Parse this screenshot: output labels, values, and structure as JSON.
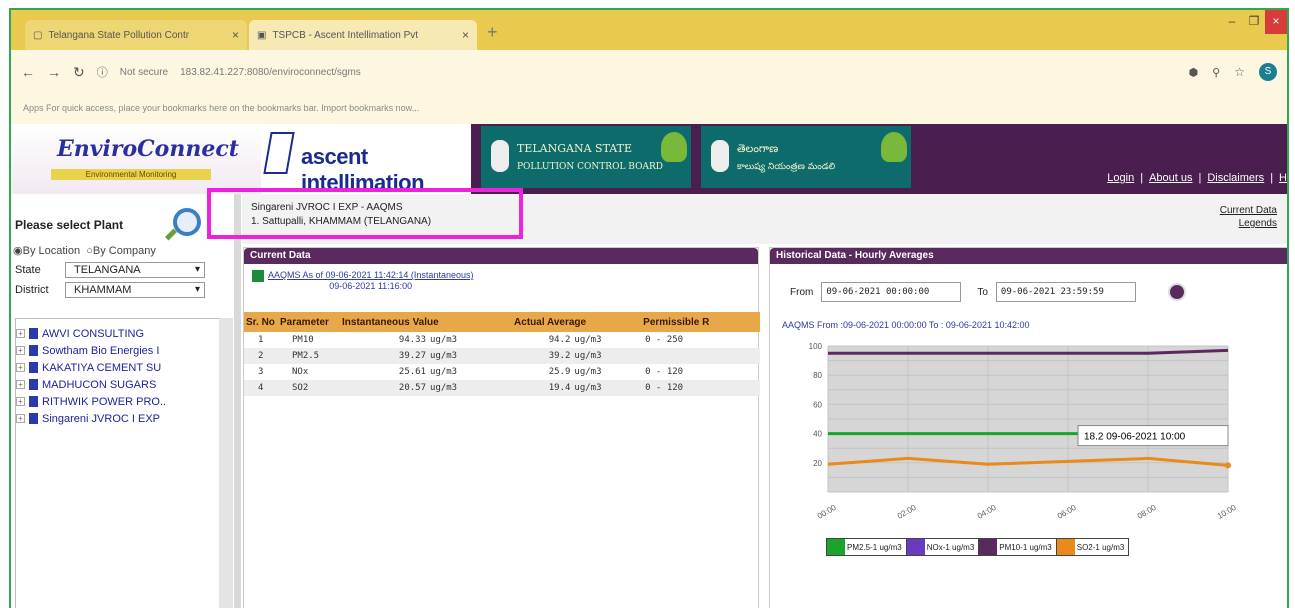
{
  "browser": {
    "tabs": [
      {
        "label": "Telangana State Pollution Contr",
        "active": false
      },
      {
        "label": "TSPCB - Ascent Intellimation Pvt",
        "active": true
      }
    ],
    "url_prefix": "Not secure",
    "url": "183.82.41.227:8080/enviroconnect/sgms",
    "bookmarks_text": "Apps   For quick access, place your bookmarks here on the bookmarks bar. Import bookmarks now...",
    "profile_initial": "S"
  },
  "header": {
    "brand": "EnviroConnect",
    "brand_sub": "Environmental Monitoring",
    "ascent": "ascent intellimation",
    "ts_line1": "TELANGANA STATE",
    "ts_line2": "POLLUTION CONTROL BOARD",
    "telugu_line1": "తెలంగాణ",
    "telugu_line2": "కాలుష్య నియంత్రణ మండలి",
    "links": [
      "Login",
      "About us",
      "Disclaimers",
      "H"
    ]
  },
  "sidebar": {
    "prompt": "Please select Plant",
    "radio_location": "By Location",
    "radio_company": "By Company",
    "state_label": "State",
    "state_value": "TELANGANA",
    "district_label": "District",
    "district_value": "KHAMMAM",
    "plants": [
      "AWVI CONSULTING",
      "Sowtham Bio Energies I",
      "KAKATIYA CEMENT SU",
      "MADHUCON SUGARS",
      "RITHWIK POWER PRO..",
      "Singareni JVROC I EXP"
    ]
  },
  "location": {
    "line1": "Singareni JVROC I EXP - AAQMS",
    "line2": "1. Sattupalli, KHAMMAM (TELANGANA)",
    "link1": "Current Data",
    "link2": "Legends"
  },
  "current": {
    "heading": "Current Data",
    "asof_line1": "AAQMS As of 09-06-2021 11:42:14 (Instantaneous)",
    "asof_line2": "09-06-2021 11:16:00",
    "columns": [
      "Sr. No",
      "Parameter",
      "Instantaneous Value",
      "Actual Average",
      "Permissible R"
    ],
    "rows": [
      [
        "1",
        "PM10",
        "94.33",
        "ug/m3",
        "94.2",
        "ug/m3",
        "0 - 250"
      ],
      [
        "2",
        "PM2.5",
        "39.27",
        "ug/m3",
        "39.2",
        "ug/m3",
        ""
      ],
      [
        "3",
        "NOx",
        "25.61",
        "ug/m3",
        "25.9",
        "ug/m3",
        "0 - 120"
      ],
      [
        "4",
        "SO2",
        "20.57",
        "ug/m3",
        "19.4",
        "ug/m3",
        "0 - 120"
      ]
    ]
  },
  "historical": {
    "heading": "Historical Data - Hourly Averages",
    "from_label": "From",
    "from_value": "09-06-2021 00:00:00",
    "to_label": "To",
    "to_value": "09-06-2021 23:59:59",
    "chart_title": "AAQMS From :09-06-2021 00:00:00 To : 09-06-2021 10:42:00",
    "tooltip": "18.2 09-06-2021 10:00"
  },
  "chart_data": {
    "type": "line",
    "x": [
      "00:00",
      "02:00",
      "04:00",
      "06:00",
      "08:00",
      "10:00"
    ],
    "yticks": [
      "100",
      "80",
      "60",
      "40",
      "20"
    ],
    "ylim": [
      0,
      100
    ],
    "grid": true,
    "legend_position": "bottom",
    "series": [
      {
        "name": "PM2.5-1 ug/m3",
        "color": "#1aa52a",
        "values": [
          40,
          40,
          40,
          40,
          40,
          40
        ]
      },
      {
        "name": "NOx-1 ug/m3",
        "color": "#6a3ac0",
        "values": [
          null,
          null,
          null,
          null,
          null,
          null
        ]
      },
      {
        "name": "PM10-1 ug/m3",
        "color": "#5a2a5e",
        "values": [
          95,
          95,
          95,
          95,
          95,
          97
        ]
      },
      {
        "name": "SO2-1 ug/m3",
        "color": "#e98a1a",
        "values": [
          19,
          23,
          19,
          21,
          23,
          18.2
        ]
      }
    ]
  }
}
